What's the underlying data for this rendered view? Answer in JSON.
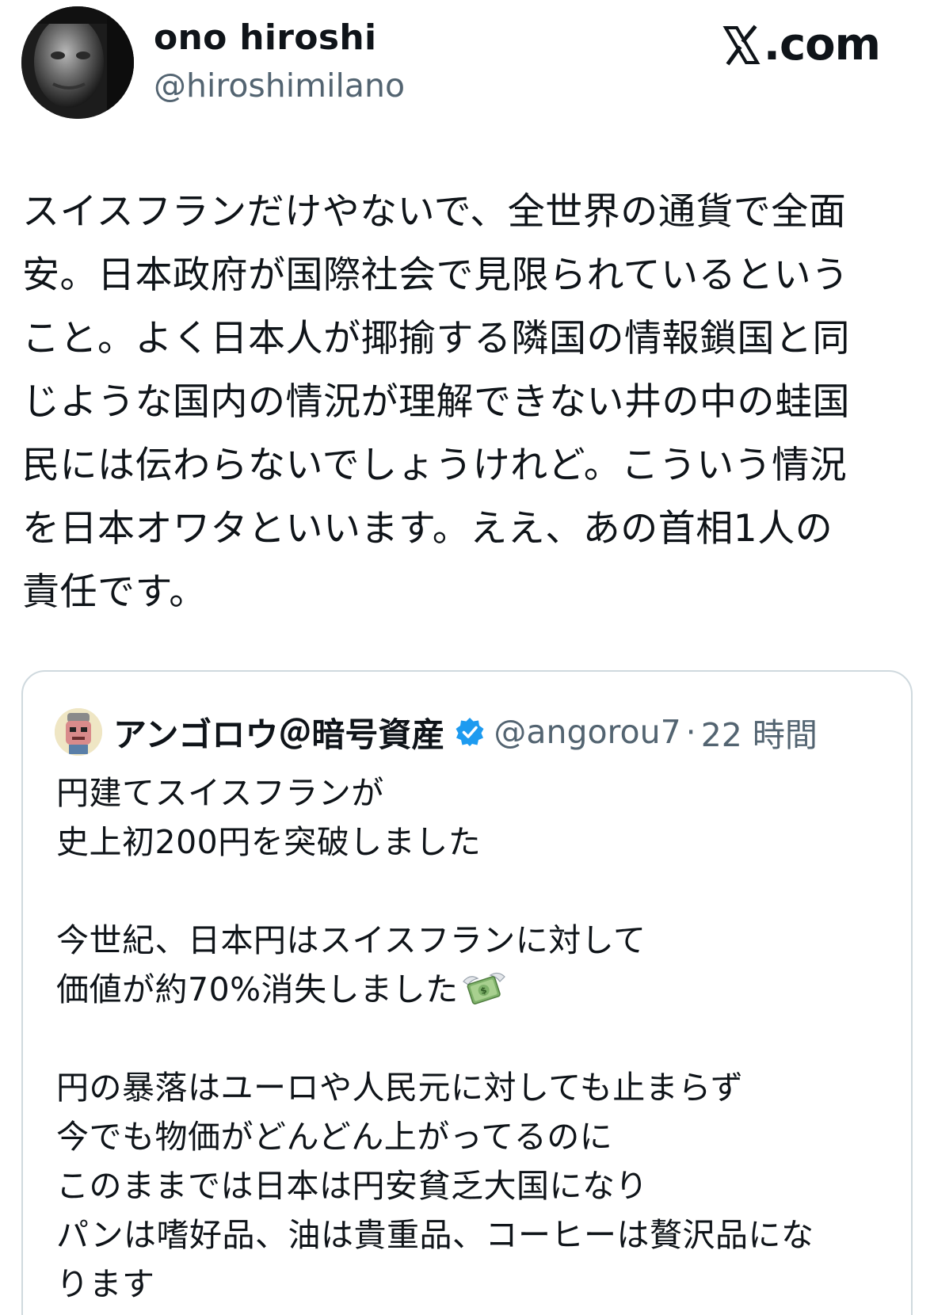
{
  "author": {
    "name": "ono hiroshi",
    "handle": "@hiroshimilano"
  },
  "site": {
    "label": ".com",
    "icon": "x-logo-icon"
  },
  "tweet": {
    "lines": [
      "スイスフランだけやないで、全世界の通貨で全面",
      "安。日本政府が国際社会で見限られているという",
      "こと。よく日本人が揶揄する隣国の情報鎖国と同",
      "じような国内の情況が理解できない井の中の蛙国",
      "民には伝わらないでしょうけれど。こういう情況",
      "を日本オワタといいます。ええ、あの首相1人の",
      "責任です。"
    ]
  },
  "quote": {
    "name": "アンゴロウ＠暗号資産",
    "verified": true,
    "handle": "@angorou7",
    "separator": "·",
    "time": "22 時間",
    "paragraphs": [
      [
        "円建てスイスフランが",
        "史上初200円を突破しました"
      ],
      [
        "今世紀、日本円はスイスフランに対して",
        "価値が約70%消失しました"
      ],
      [
        "円の暴落はユーロや人民元に対しても止まらず",
        "今でも物価がどんどん上がってるのに",
        "このままでは日本は円安貧乏大国になり",
        "パンは嗜好品、油は貴重品、コーヒーは贅沢品にな",
        "ります"
      ]
    ],
    "emoji": "money-with-wings-icon"
  }
}
